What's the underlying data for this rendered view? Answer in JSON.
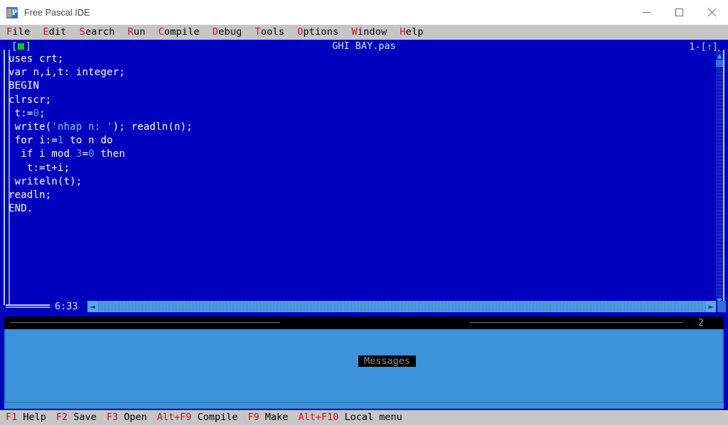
{
  "window": {
    "title": "Free Pascal IDE",
    "icon": "free-pascal-icon",
    "controls": {
      "minimize": "minimize-icon",
      "maximize": "maximize-icon",
      "close": "close-icon"
    }
  },
  "menubar": {
    "items": [
      {
        "hotkey": "F",
        "rest": "ile"
      },
      {
        "hotkey": "E",
        "rest": "dit"
      },
      {
        "hotkey": "S",
        "rest": "earch"
      },
      {
        "hotkey": "R",
        "rest": "un"
      },
      {
        "hotkey": "C",
        "rest": "ompile"
      },
      {
        "hotkey": "D",
        "rest": "ebug"
      },
      {
        "hotkey": "T",
        "rest": "ools"
      },
      {
        "hotkey": "O",
        "rest": "ptions"
      },
      {
        "hotkey": "W",
        "rest": "indow"
      },
      {
        "hotkey": "H",
        "rest": "elp"
      }
    ]
  },
  "editor": {
    "title": "GHI BAY.pas",
    "window_number": "1",
    "close_box": "[■]",
    "zoom_box": "[↑]",
    "cursor_position": "6:33",
    "code_lines": [
      {
        "text": "uses crt;"
      },
      {
        "text": "var n,i,t: integer;"
      },
      {
        "text": "BEGIN"
      },
      {
        "text": "clrscr;"
      },
      {
        "text": " t:=",
        "num": "0",
        "tail": ";"
      },
      {
        "text": " write(",
        "str": "'nhap n: '",
        "tail": "); readln(n);"
      },
      {
        "text": " for i:=",
        "num": "1",
        "tail": " to n do"
      },
      {
        "text": "  if i mod ",
        "num": "3",
        "mid": "=",
        "num2": "0",
        "tail": " then"
      },
      {
        "text": "   t:=t+i;"
      },
      {
        "text": " writeln(t);"
      },
      {
        "text": "readln;"
      },
      {
        "text": "END."
      }
    ],
    "code_plain": "uses crt;\nvar n,i,t: integer;\nBEGIN\nclrscr;\n t:=0;\n write('nhap n: '); readln(n);\n for i:=1 to n do\n  if i mod 3=0 then\n   t:=t+i;\n writeln(t);\nreadln;\nEND.",
    "scroll": {
      "up_arrow": "▲",
      "down_arrow": "▼",
      "left_arrow": "◄",
      "right_arrow": "►"
    }
  },
  "messages": {
    "title": "Messages",
    "window_number": "2",
    "content": ""
  },
  "statusbar": {
    "keys": [
      {
        "key": "F1",
        "label": " Help"
      },
      {
        "key": "F2",
        "label": " Save"
      },
      {
        "key": "F3",
        "label": " Open"
      },
      {
        "key": "Alt+F9",
        "label": " Compile"
      },
      {
        "key": "F9",
        "label": " Make"
      },
      {
        "key": "Alt+F10",
        "label": " Local menu"
      }
    ]
  },
  "colors": {
    "desktop_blue": "#0000bf",
    "editor_text": "#ffffff",
    "number_literal": "#5da0e0",
    "string_literal": "#7fc4ec",
    "menu_hotkey_red": "#d01010",
    "menu_bg": "#c6c6c6",
    "messages_bg": "#3d93d9",
    "title_inactive": "#8c8c8c"
  }
}
